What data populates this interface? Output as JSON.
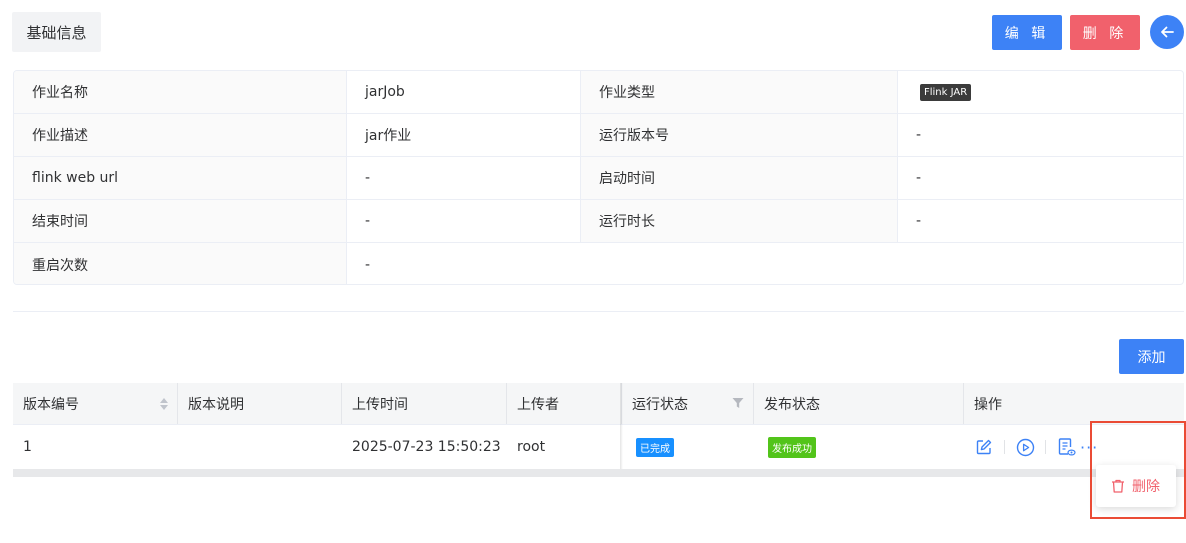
{
  "header": {
    "section_title": "基础信息",
    "edit_label": "编 辑",
    "delete_label": "删 除"
  },
  "info": {
    "rows": [
      [
        {
          "label": "作业名称",
          "value": "jarJob"
        },
        {
          "label": "作业类型",
          "tag": "Flink JAR"
        }
      ],
      [
        {
          "label": "作业描述",
          "value": "jar作业"
        },
        {
          "label": "运行版本号",
          "value": "-"
        }
      ],
      [
        {
          "label": "flink web url",
          "value": "-"
        },
        {
          "label": "启动时间",
          "value": "-"
        }
      ],
      [
        {
          "label": "结束时间",
          "value": "-"
        },
        {
          "label": "运行时长",
          "value": "-"
        }
      ],
      [
        {
          "label": "重启次数",
          "value": "-"
        }
      ]
    ]
  },
  "versions": {
    "add_label": "添加",
    "columns": [
      "版本编号",
      "版本说明",
      "上传时间",
      "上传者",
      "运行状态",
      "发布状态",
      "操作"
    ],
    "rows": [
      {
        "version_no": "1",
        "description": "",
        "upload_time": "2025-07-23 15:50:23",
        "uploader": "root",
        "run_status": "已完成",
        "publish_status": "发布成功"
      }
    ],
    "more_label": "···",
    "dropdown": {
      "delete_label": "删除"
    }
  },
  "colors": {
    "primary": "#3d82f6",
    "danger": "#f1616c",
    "success": "#52c41a",
    "info_tag": "#1890ff",
    "highlight": "#ea4b35"
  },
  "icons": [
    "arrow-left-icon",
    "sort-icon",
    "filter-icon",
    "edit-icon",
    "play-icon",
    "file-view-icon",
    "trash-icon"
  ]
}
